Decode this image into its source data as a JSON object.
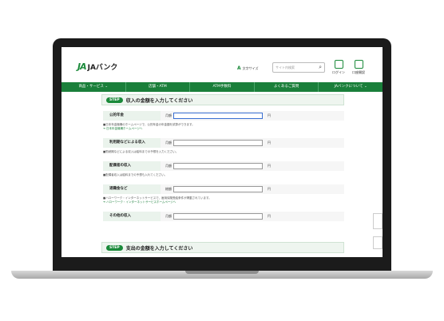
{
  "header": {
    "logo_mark": "JA",
    "logo_text": "JAバンク",
    "font_size_label": "文字サイズ",
    "search": {
      "placeholder": "サイト内検索"
    },
    "login_label": "ログイン",
    "open_account_label": "口座開設"
  },
  "nav": [
    "商品・サービス ⌄",
    "店舗・ATM",
    "ATM手数料",
    "よくあるご質問",
    "JAバンクについて ⌄"
  ],
  "step1": {
    "badge": "STEP",
    "title": "収入の金額を入力してください"
  },
  "rows": [
    {
      "label": "公的年金",
      "prefix": "月額",
      "unit": "円"
    },
    {
      "label": "利用期などによる収入",
      "prefix": "月額",
      "unit": "円"
    },
    {
      "label": "配偶者の収入",
      "prefix": "月額",
      "unit": "円"
    },
    {
      "label": "退職金など",
      "prefix": "総額",
      "unit": "円"
    },
    {
      "label": "その他の収入",
      "prefix": "月額",
      "unit": "円"
    }
  ],
  "notes": [
    "■日本年金機構のホームページで、公的年金の年金額を試算ができます。",
    "➔ 日本年金機構ホームページへ",
    "■勤続期などによる収入は給料までの予想を入力ください。",
    "■配偶者収入は給料までの予想も入れてください。",
    "■ハローワーク・インターネットサービスで、雇用保険受給条件が掲載されています。",
    "➔ ハローワーク・インターネットサービスホームページへ"
  ],
  "step2": {
    "badge": "STEP",
    "title": "支出の金額を入力してください"
  }
}
